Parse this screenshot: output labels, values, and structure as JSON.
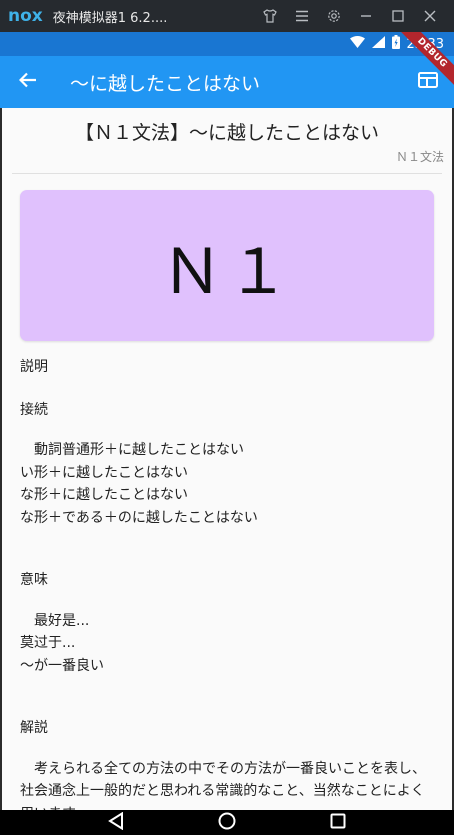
{
  "emulator": {
    "logo": "nox",
    "title": "夜神模拟器1 6.2...."
  },
  "status_bar": {
    "time": "23:33",
    "debug_label": "DEBUG"
  },
  "app_bar": {
    "title": "〜に越したことはない"
  },
  "article": {
    "title": "【Ｎ１文法】〜に越したことはない",
    "tag": "Ｎ１文法",
    "banner_text": "Ｎ１",
    "banner_color": "#e0c1fd",
    "sections": {
      "explanation_label": "説明",
      "connection_label": "接続",
      "connection_text": "　動詞普通形＋に越したことはない\nい形＋に越したことはない\nな形＋に越したことはない\nな形＋である＋のに越したことはない",
      "meaning_label": "意味",
      "meaning_text": "　最好是...\n莫过于...\n〜が一番良い",
      "commentary_label": "解説",
      "commentary_text": "　考えられる全ての方法の中でその方法が一番良いことを表し、社会通念上一般的だと思われる常識的なこと、当然なことによく用います。"
    }
  },
  "colors": {
    "app_bar": "#2196f3",
    "status_bar": "#1976d2"
  }
}
